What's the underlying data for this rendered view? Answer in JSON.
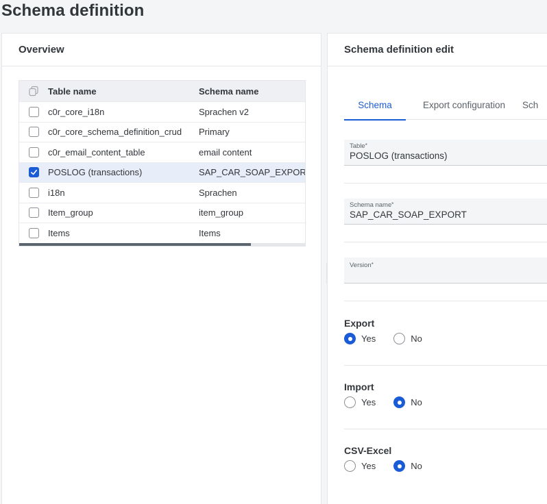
{
  "page": {
    "title": "Schema definition"
  },
  "overview": {
    "title": "Overview",
    "columns": {
      "table_name": "Table name",
      "schema_name": "Schema name"
    },
    "rows": [
      {
        "table": "c0r_core_i18n",
        "schema": "Sprachen v2",
        "checked": false
      },
      {
        "table": "c0r_core_schema_definition_crud",
        "schema": "Primary",
        "checked": false
      },
      {
        "table": "c0r_email_content_table",
        "schema": "email content",
        "checked": false
      },
      {
        "table": "POSLOG (transactions)",
        "schema": "SAP_CAR_SOAP_EXPORT",
        "checked": true
      },
      {
        "table": "i18n",
        "schema": "Sprachen",
        "checked": false
      },
      {
        "table": "Item_group",
        "schema": "item_group",
        "checked": false
      },
      {
        "table": "Items",
        "schema": "Items",
        "checked": false
      }
    ]
  },
  "edit": {
    "title": "Schema definition edit",
    "tabs": [
      "Schema",
      "Export configuration",
      "Sch"
    ],
    "fields": {
      "table": {
        "label": "Table",
        "value": "POSLOG (transactions)"
      },
      "schema_name": {
        "label": "Schema name",
        "value": "SAP_CAR_SOAP_EXPORT"
      },
      "version": {
        "label": "Version",
        "value": ""
      }
    },
    "groups": {
      "export": {
        "label": "Export",
        "yes": "Yes",
        "no": "No",
        "selected": "yes"
      },
      "import": {
        "label": "Import",
        "yes": "Yes",
        "no": "No",
        "selected": "no"
      },
      "csv": {
        "label": "CSV-Excel",
        "yes": "Yes",
        "no": "No",
        "selected": "no"
      }
    }
  },
  "colors": {
    "accent": "#1a5bd6"
  }
}
